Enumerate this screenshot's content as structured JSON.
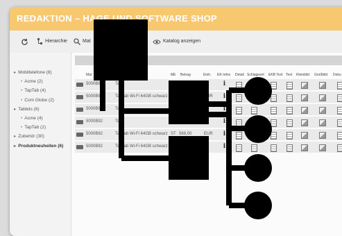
{
  "window": {
    "title": "REDAKTION – HAGE UND SOFTWARE SHOP"
  },
  "toolbar": {
    "hierarchy_label": "Hierarchie",
    "search_label": "Mat",
    "catalog_label": "Katalog anzeigen"
  },
  "sidebar": {
    "items": [
      {
        "label": "Mobiltelefone (8)"
      },
      {
        "label": "Acme (2)"
      },
      {
        "label": "TapTab (4)"
      },
      {
        "label": "Com Globe (2)"
      },
      {
        "label": "Tablets (6)"
      },
      {
        "label": "Acme (4)"
      },
      {
        "label": "TapTab (2)"
      },
      {
        "label": "Zubehör (30)"
      },
      {
        "label": "Produktneuheiten (6)"
      }
    ]
  },
  "table": {
    "headers": {
      "mat": "Mat",
      "me": "ME",
      "betrag": "Betrag",
      "einh": "Einh.",
      "ekinfos": "EK-Infos",
      "detail": "Detail",
      "schlagwort": "Schlagwort",
      "ekbtext": "EKB Text",
      "text": "Text",
      "kleinbild": "Kleinbild",
      "grossbild": "Großbild",
      "dok": "Doku"
    },
    "rows": [
      {
        "mat": "5000B92",
        "desc": "Ta",
        "me": "",
        "betrag": "",
        "einh": ""
      },
      {
        "mat": "5000B92",
        "desc": "TapTab Wi-Fi 64GB schwarz",
        "me": "ST",
        "betrag": "569,00",
        "einh": "EUR"
      },
      {
        "mat": "5000B92",
        "desc": "Ta",
        "me": "",
        "betrag": "",
        "einh": ""
      },
      {
        "mat": "5000B92",
        "desc": "Ta",
        "me": "",
        "betrag": "",
        "einh": ""
      },
      {
        "mat": "5000B92",
        "desc": "TapTab Wi-Fi 64GB schwarz",
        "me": "ST",
        "betrag": "569,00",
        "einh": "EUR"
      },
      {
        "mat": "5000B92",
        "desc": "TapTab Wi-Fi 64GB schwarz",
        "me": "",
        "betrag": "",
        "einh": ""
      }
    ]
  },
  "colors": {
    "title_bar": "#f8c870",
    "overlay": "#000000"
  },
  "icons": {
    "refresh": "refresh-icon",
    "hierarchy": "hierarchy-icon",
    "search": "search-icon",
    "eye": "eye-icon",
    "device": "device-icon",
    "info": "info-icon",
    "document": "document-icon",
    "image": "image-icon"
  }
}
